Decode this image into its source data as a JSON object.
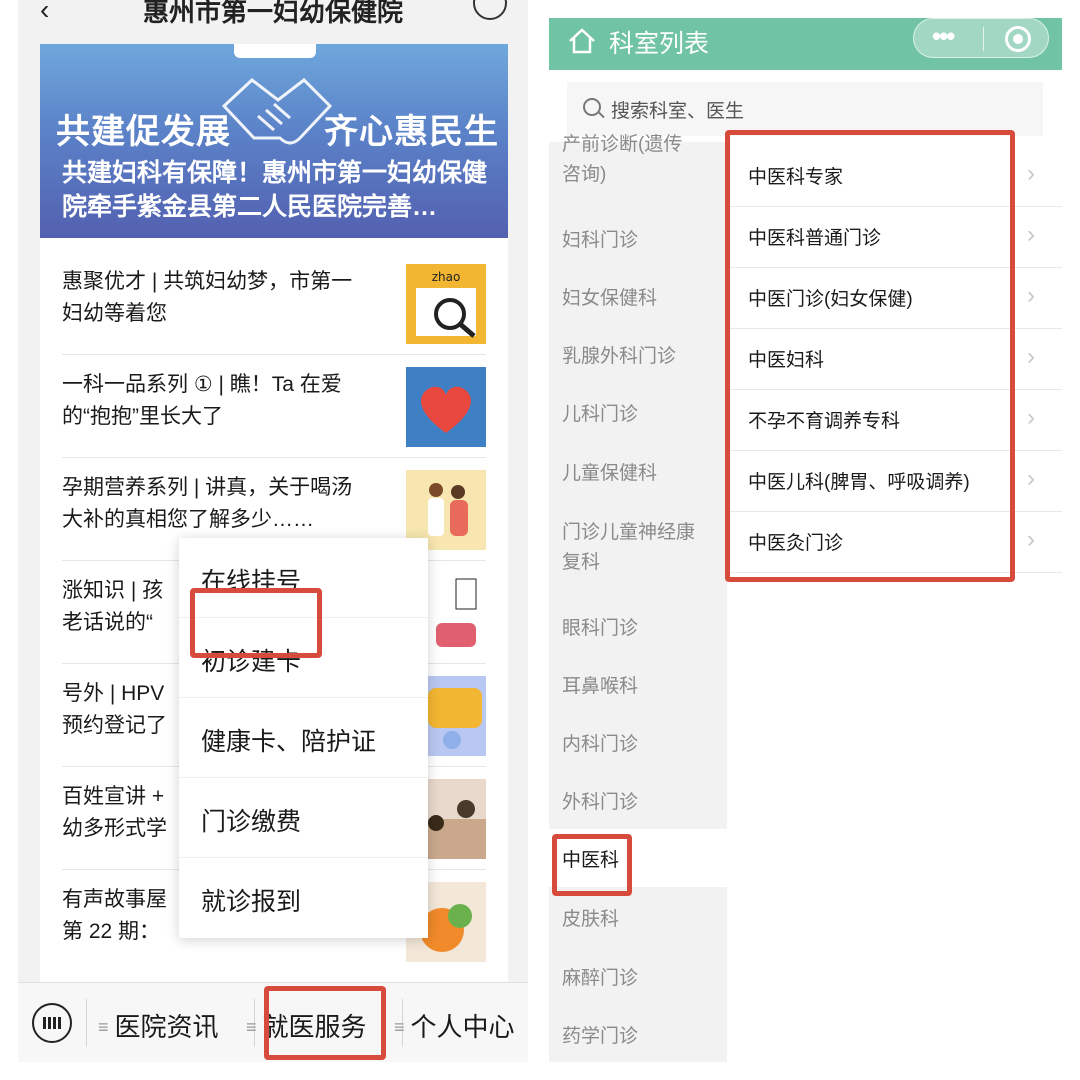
{
  "left_screen": {
    "topbar": {
      "title": "惠州市第一妇幼保健院"
    },
    "banner": {
      "slogan_left": "共建促发展",
      "slogan_right": "齐心惠民生",
      "headline": "共建妇科有保障！惠州市第一妇幼保健院牵手紫金县第二人民医院完善…"
    },
    "news": [
      {
        "title": "惠聚优才 | 共筑妇幼梦，市第一\n妇幼等着您",
        "thumb_text": "zhao"
      },
      {
        "title": "一科一品系列 ① | 瞧！Ta 在爱\n的“抱抱”里长大了"
      },
      {
        "title": "孕期营养系列 | 讲真，关于喝汤\n大补的真相您了解多少……"
      },
      {
        "title": "涨知识 | 孩\n老话说的“"
      },
      {
        "title": "号外 | HPV\n预约登记了"
      },
      {
        "title": "百姓宣讲 +\n幼多形式学"
      },
      {
        "title": "有声故事屋\n第 22 期："
      }
    ],
    "popup_menu": [
      "在线挂号",
      "初诊建卡",
      "健康卡、陪护证",
      "门诊缴费",
      "就诊报到"
    ],
    "bottom_tabs": [
      "医院资讯",
      "就医服务",
      "个人中心"
    ]
  },
  "right_screen": {
    "header": {
      "title": "科室列表",
      "capsule_dots": "•••"
    },
    "search": {
      "placeholder": "搜索科室、医生"
    },
    "departments": [
      "产前诊断(遗传\n咨询)",
      "妇科门诊",
      "妇女保健科",
      "乳腺外科门诊",
      "儿科门诊",
      "儿童保健科",
      "门诊儿童神经康\n复科",
      "眼科门诊",
      "耳鼻喉科",
      "内科门诊",
      "外科门诊",
      "中医科",
      "皮肤科",
      "麻醉门诊",
      "药学门诊"
    ],
    "selected_department": "中医科",
    "sub_departments": [
      "中医科专家",
      "中医科普通门诊",
      "中医门诊(妇女保健)",
      "中医妇科",
      "不孕不育调养专科",
      "中医儿科(脾胃、呼吸调养)",
      "中医灸门诊"
    ]
  },
  "colors": {
    "highlight": "#d64b3c",
    "header_green": "#70c4a4"
  }
}
